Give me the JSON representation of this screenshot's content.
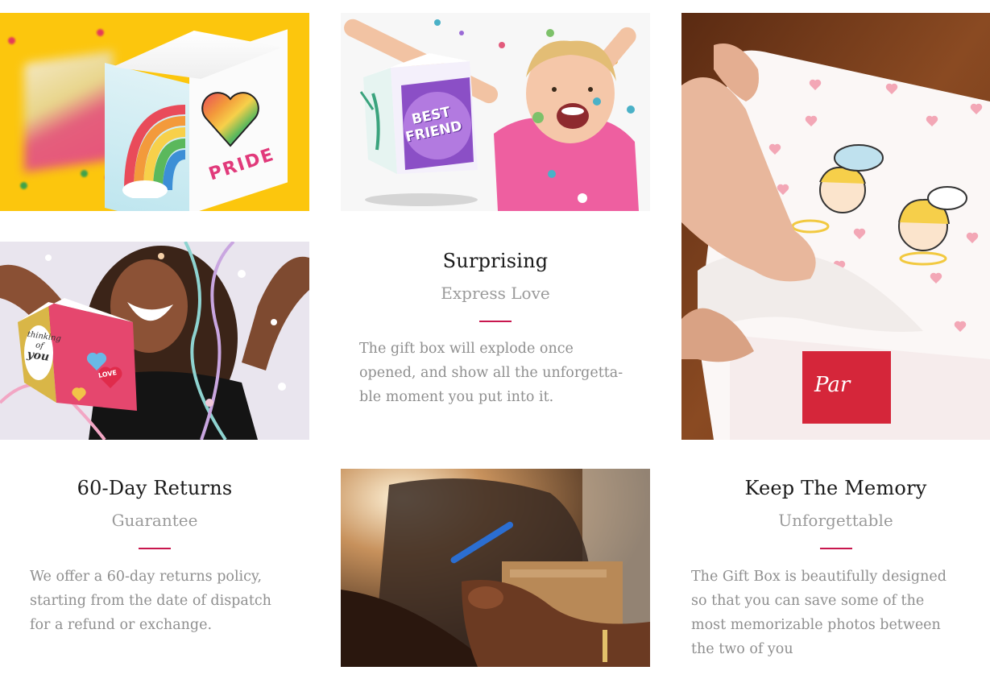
{
  "colors": {
    "accent_divider": "#c8174e",
    "title_text": "#1a1a1a",
    "subtitle_text": "#9a9a9a",
    "body_text": "#8f8f8f",
    "pride_background": "#fcc60d"
  },
  "images": {
    "pride_box": {
      "box_text": "PRIDE"
    },
    "child_confetti": {
      "box_text_line1": "BEST",
      "box_text_line2": "FRIEND"
    },
    "woman_laughing": {
      "box_text_line1": "thinking",
      "box_text_line2": "of",
      "box_text_line3": "you",
      "heart_text": "LOVE"
    },
    "cupid_box": {
      "card_text": "Par"
    }
  },
  "features": {
    "surprising": {
      "title": "Surprising",
      "subtitle": "Express Love",
      "body_lines": [
        "The gift box will explode once",
        "opened, and show all the unforgetta-",
        "ble moment you put into it."
      ]
    },
    "returns": {
      "title": "60-Day Returns",
      "subtitle": "Guarantee",
      "body_lines": [
        "We offer a 60-day returns policy,",
        "starting from the date of dispatch",
        "for a refund or exchange."
      ]
    },
    "memory": {
      "title": "Keep The Memory",
      "subtitle": "Unforgettable",
      "body_lines": [
        "The Gift Box is beautifully designed",
        "so that you can save some of the",
        "most memorizable photos between",
        "the two of you"
      ]
    }
  }
}
